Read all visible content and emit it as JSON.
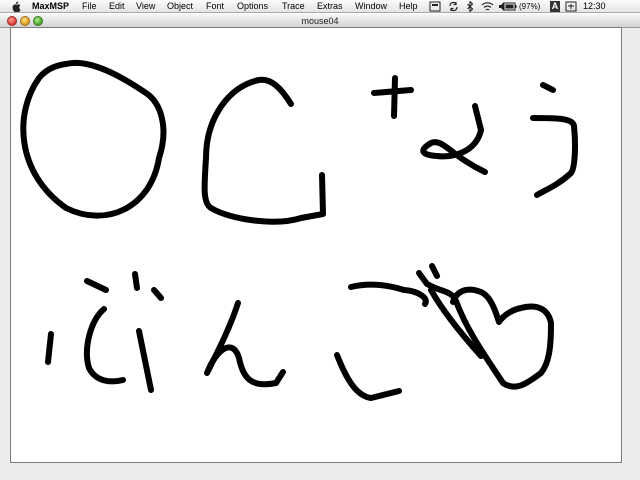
{
  "menubar": {
    "app_name": "MaxMSP",
    "items": [
      "File",
      "Edit",
      "View",
      "Object",
      "Font",
      "Options",
      "Trace",
      "Extras",
      "Window",
      "Help"
    ],
    "battery_text": "(97%)",
    "input_menu_label": "A",
    "clock": "12:30",
    "icons": [
      "apple-icon",
      "script-menu-icon",
      "sync-icon",
      "bluetooth-icon",
      "airport-wifi-icon",
      "volume-icon",
      "battery-icon",
      "input-menu-icon",
      "spotlight-icon"
    ]
  },
  "window": {
    "title": "mouse04",
    "buttons": [
      "close",
      "minimize",
      "zoom"
    ]
  },
  "canvas": {
    "background": "#ffffff",
    "stroke_color": "#000000",
    "drawn_shapes": [
      "circle",
      "letter-G",
      "character-na",
      "character-yo",
      "character-u",
      "character-bu",
      "character-n",
      "character-go",
      "heart"
    ]
  }
}
